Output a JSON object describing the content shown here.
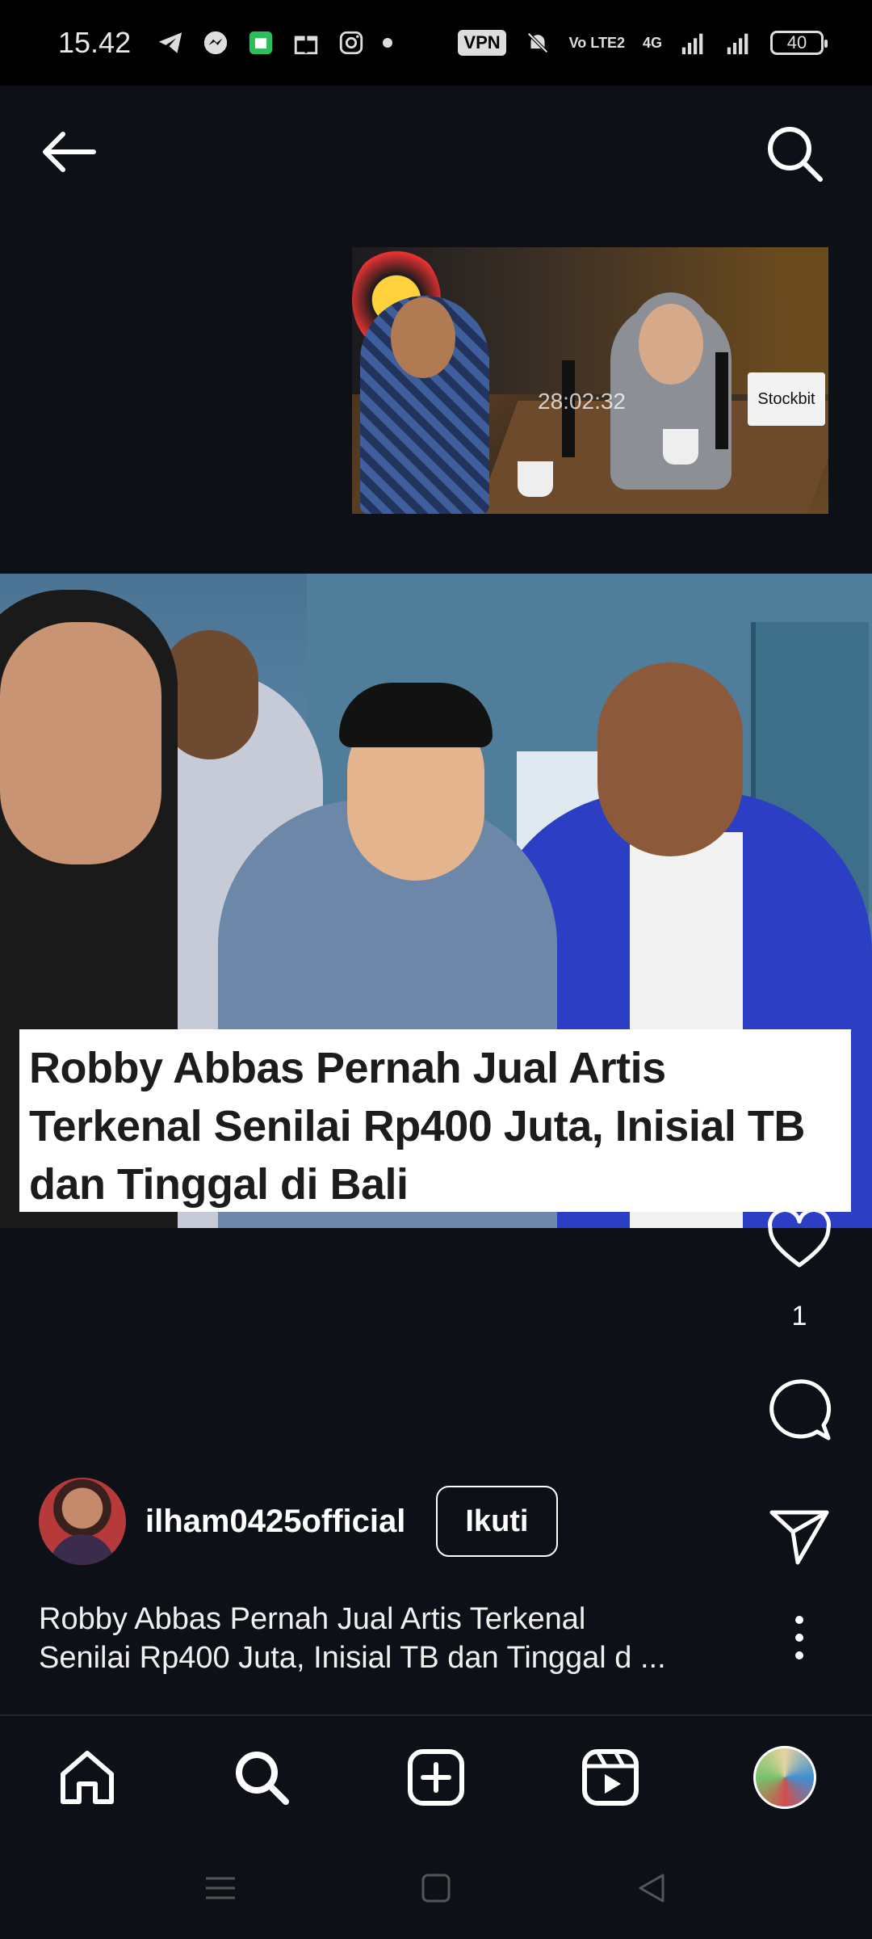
{
  "status_bar": {
    "time": "15.42",
    "vpn": "VPN",
    "volte": "Vo LTE2",
    "network": "4G",
    "battery": "40"
  },
  "thumbnail": {
    "timestamp": "28:02:32",
    "brand_label": "Stockbit"
  },
  "post": {
    "headline": "Robby Abbas Pernah Jual Artis Terkenal Senilai Rp400 Juta, Inisial TB dan Tinggal di Bali",
    "likes": "1",
    "username": "ilham0425official",
    "follow_label": "Ikuti",
    "caption_line1": "Robby Abbas Pernah Jual Artis Terkenal",
    "caption_line2": "Senilai Rp400 Juta, Inisial TB dan Tinggal d ..."
  },
  "nav": {
    "items": [
      "home-icon",
      "search-icon",
      "add-post-icon",
      "reels-icon",
      "profile-avatar"
    ]
  }
}
